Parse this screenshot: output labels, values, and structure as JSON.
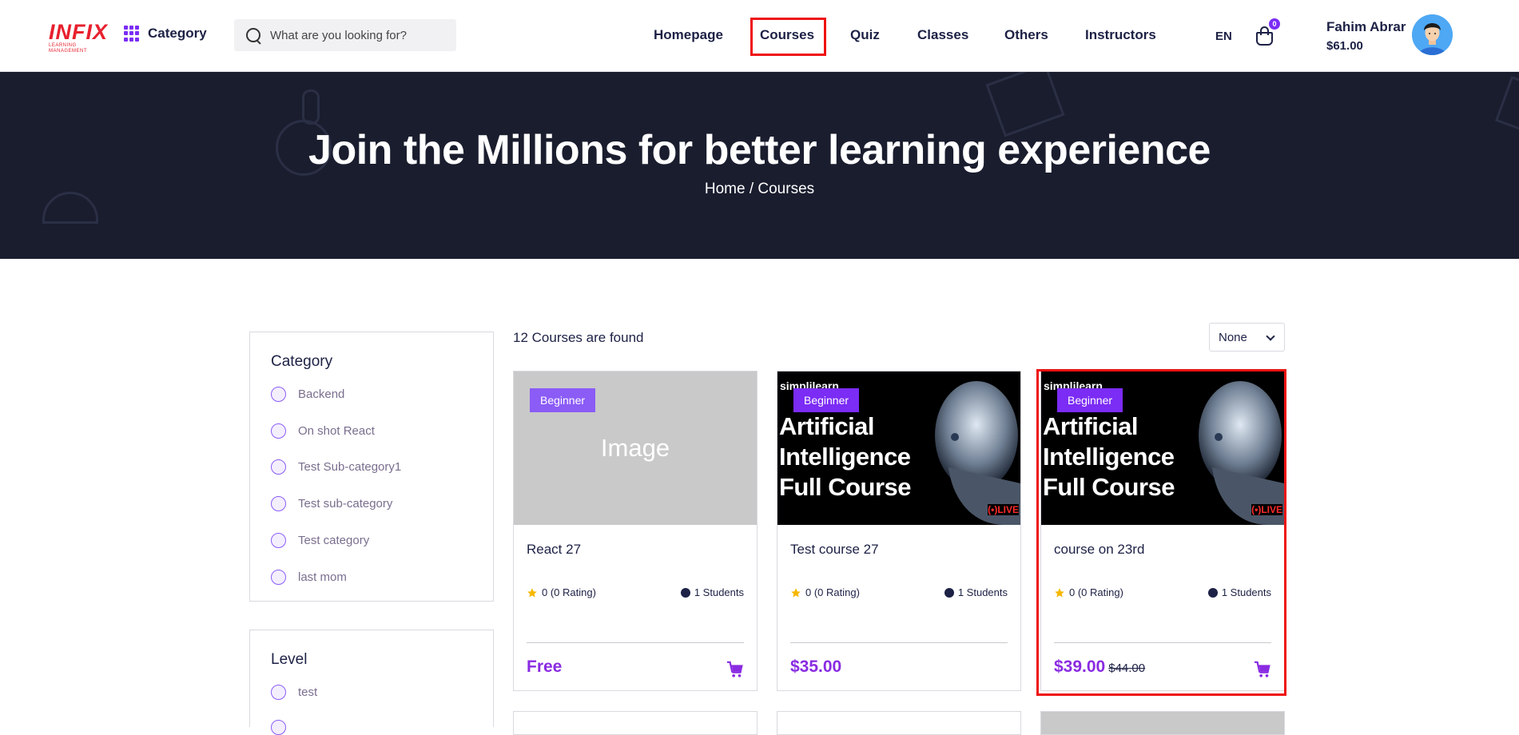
{
  "header": {
    "logo_text": "INFIX",
    "logo_sub": "LEARNING MANAGEMENT",
    "category_label": "Category",
    "search_placeholder": "What are you looking for?",
    "nav": [
      "Homepage",
      "Courses",
      "Quiz",
      "Classes",
      "Others",
      "Instructors"
    ],
    "active_nav": "Courses",
    "lang": "EN",
    "cart_count": "0",
    "user_name": "Fahim Abrar",
    "user_balance": "$61.00"
  },
  "hero": {
    "title": "Join the Millions for better learning experience",
    "breadcrumb_home": "Home",
    "breadcrumb_sep": "/",
    "breadcrumb_current": "Courses"
  },
  "filters": {
    "category": {
      "title": "Category",
      "options": [
        "Backend",
        "On shot React",
        "Test Sub-category1",
        "Test sub-category",
        "Test category",
        "last mom"
      ]
    },
    "level": {
      "title": "Level",
      "options": [
        "test"
      ]
    }
  },
  "listing": {
    "found_text": "12 Courses are found",
    "sort_value": "None"
  },
  "courses": [
    {
      "title": "React 27",
      "level": "Beginner",
      "image_text": "Image",
      "rating": "0 (0 Rating)",
      "students": "1 Students",
      "price": "Free",
      "old_price": ""
    },
    {
      "title": "Test course 27",
      "level": "Beginner",
      "thumb_brand": "simplilearn",
      "thumb_lines": [
        "Artificial",
        "Intelligence",
        "Full Course"
      ],
      "thumb_live": "LIVE",
      "rating": "0 (0 Rating)",
      "students": "1 Students",
      "price": "$35.00",
      "old_price": ""
    },
    {
      "title": "course on 23rd",
      "level": "Beginner",
      "thumb_brand": "simplilearn",
      "thumb_lines": [
        "Artificial",
        "Intelligence",
        "Full Course"
      ],
      "thumb_live": "LIVE",
      "rating": "0 (0 Rating)",
      "students": "1 Students",
      "price": "$39.00",
      "old_price": "$44.00"
    }
  ],
  "colors": {
    "accent": "#7b2cf5",
    "price": "#8a2be2",
    "hero_bg": "#1a1d2e",
    "highlight": "#ee1111"
  }
}
